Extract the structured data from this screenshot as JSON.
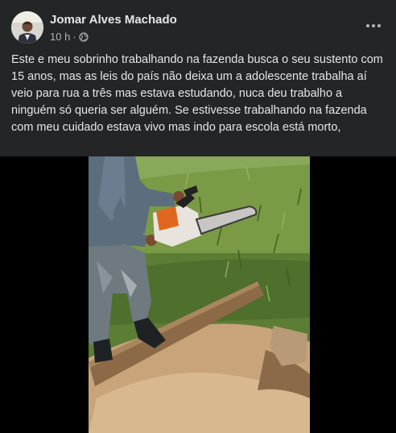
{
  "post": {
    "author": "Jomar Alves Machado",
    "time": "10 h",
    "separator": "·",
    "audience_icon": "globe-icon",
    "more_icon": "more-options-icon",
    "text": "Este e meu sobrinho trabalhando na fazenda busca o seu sustento com 15 anos, mas as leis do país não deixa um a adolescente trabalha aí veio para rua a três mas estava estudando, nuca deu trabalho a ninguém só queria ser alguém. Se estivesse trabalhando na fazenda com meu cuidado estava vivo mas indo para escola está morto,"
  },
  "colors": {
    "background": "#242526",
    "text_primary": "#e4e6eb",
    "text_secondary": "#b0b3b8",
    "media_letterbox": "#000000"
  }
}
